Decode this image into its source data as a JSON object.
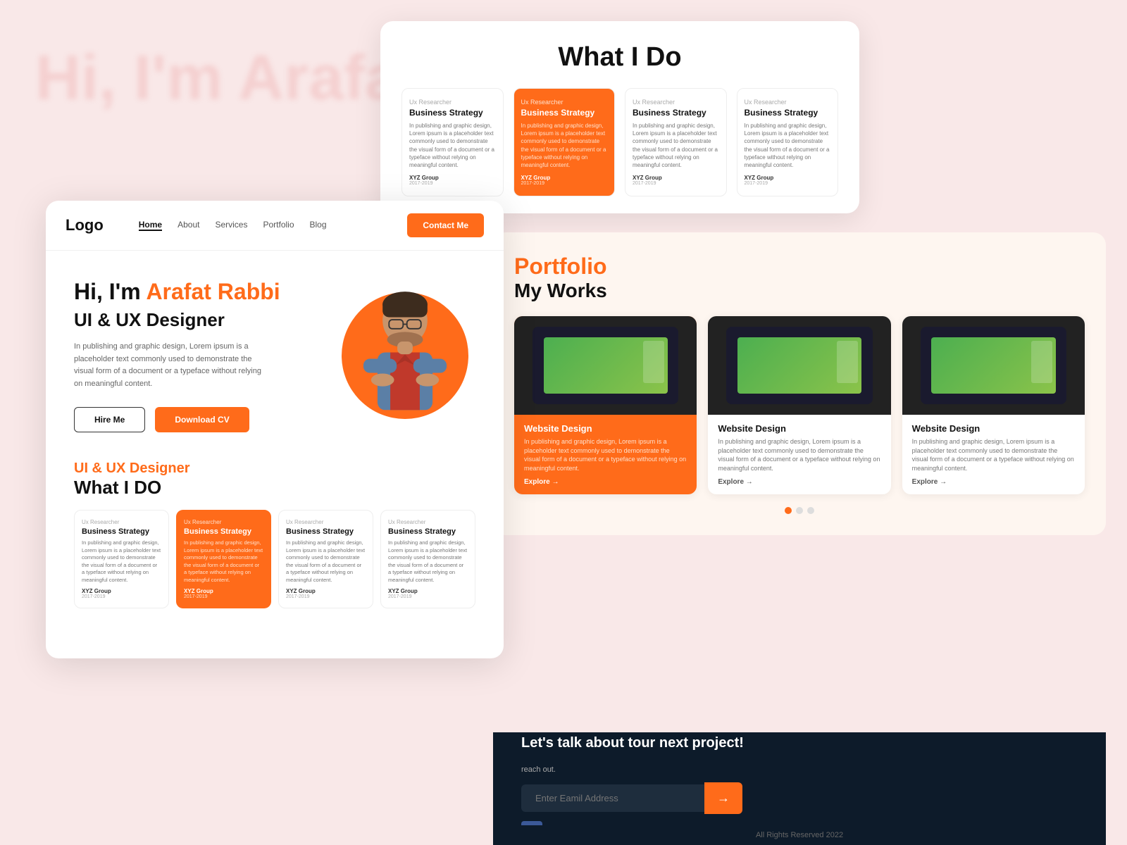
{
  "page": {
    "bgText": "Hi, I'm Arafat Rabbi"
  },
  "backCard": {
    "title": "What I Do",
    "services": [
      {
        "role": "Ux Researcher",
        "title": "Business Strategy",
        "desc": "In publishing and graphic design, Lorem ipsum is a placeholder text commonly used to demonstrate the visual form of a document or a typeface without relying on meaningful content.",
        "company": "XYZ Group",
        "year": "2017-2019",
        "active": false
      },
      {
        "role": "Ux Researcher",
        "title": "Business Strategy",
        "desc": "In publishing and graphic design, Lorem ipsum is a placeholder text commonly used to demonstrate the visual form of a document or a typeface without relying on meaningful content.",
        "company": "XYZ Group",
        "year": "2017-2019",
        "active": true
      },
      {
        "role": "Ux Researcher",
        "title": "Business Strategy",
        "desc": "In publishing and graphic design, Lorem ipsum is a placeholder text commonly used to demonstrate the visual form of a document or a typeface without relying on meaningful content.",
        "company": "XYZ Group",
        "year": "2017-2019",
        "active": false
      },
      {
        "role": "Ux Researcher",
        "title": "Business Strategy",
        "desc": "In publishing and graphic design, Lorem ipsum is a placeholder text commonly used to demonstrate the visual form of a document or a typeface without relying on meaningful content.",
        "company": "XYZ Group",
        "year": "2017-2019",
        "active": false
      }
    ]
  },
  "portfolio": {
    "label": "Portfolio",
    "sub": "My Works",
    "cards": [
      {
        "title": "Website Design",
        "desc": "In publishing and graphic design, Lorem ipsum is a placeholder text commonly used to demonstrate the visual form of a document or a typeface without relying on meaningful content.",
        "explore": "Explore →",
        "highlighted": true
      },
      {
        "title": "Website Design",
        "desc": "In publishing and graphic design, Lorem ipsum is a placeholder text commonly used to demonstrate the visual form of a document or a typeface without relying on meaningful content.",
        "explore": "Explore →",
        "highlighted": false
      },
      {
        "title": "Website Design",
        "desc": "In publishing and graphic design, Lorem ipsum is a placeholder text commonly used to demonstrate the visual form of a document or a typeface without relying on meaningful content.",
        "explore": "Explore →",
        "highlighted": false
      }
    ]
  },
  "footer": {
    "cta": "Let's talk about tour next project!",
    "note": "reach out.",
    "emailPlaceholder": "Enter Eamil Address",
    "socialIcon": "f",
    "copyright": "All Rights Reserved 2022"
  },
  "navbar": {
    "logo": "Logo",
    "links": [
      "Home",
      "About",
      "Services",
      "Portfolio",
      "Blog"
    ],
    "activeLink": "Home",
    "ctaLabel": "Contact Me"
  },
  "hero": {
    "greeting": "Hi, I'm",
    "name": "Arafat Rabbi",
    "role": "UI & UX Designer",
    "desc": "In publishing and graphic design, Lorem ipsum is a placeholder text commonly used to demonstrate the visual form of a document or a typeface without relying on meaningful content.",
    "hireMe": "Hire Me",
    "downloadCV": "Download CV"
  },
  "whatIDo": {
    "sub": "UI & UX Designer",
    "title": "What I DO",
    "services": [
      {
        "role": "Ux Researcher",
        "title": "Business Strategy",
        "desc": "In publishing and graphic design, Lorem ipsum is a placeholder text commonly used to demonstrate the visual form of a document or a typeface without relying on meaningful content.",
        "company": "XYZ Group",
        "year": "2017-2019",
        "active": false
      },
      {
        "role": "Ux Researcher",
        "title": "Business Strategy",
        "desc": "In publishing and graphic design, Lorem ipsum is a placeholder text commonly used to demonstrate the visual form of a document or a typeface without relying on meaningful content.",
        "company": "XYZ Group",
        "year": "2017-2019",
        "active": true
      },
      {
        "role": "Ux Researcher",
        "title": "Business Strategy",
        "desc": "In publishing and graphic design, Lorem ipsum is a placeholder text commonly used to demonstrate the visual form of a document or a typeface without relying on meaningful content.",
        "company": "XYZ Group",
        "year": "2017-2019",
        "active": false
      },
      {
        "role": "Ux Researcher",
        "title": "Business Strategy",
        "desc": "In publishing and graphic design, Lorem ipsum is a placeholder text commonly used to demonstrate the visual form of a document or a typeface without relying on meaningful content.",
        "company": "XYZ Group",
        "year": "2017-2019",
        "active": false
      }
    ]
  }
}
